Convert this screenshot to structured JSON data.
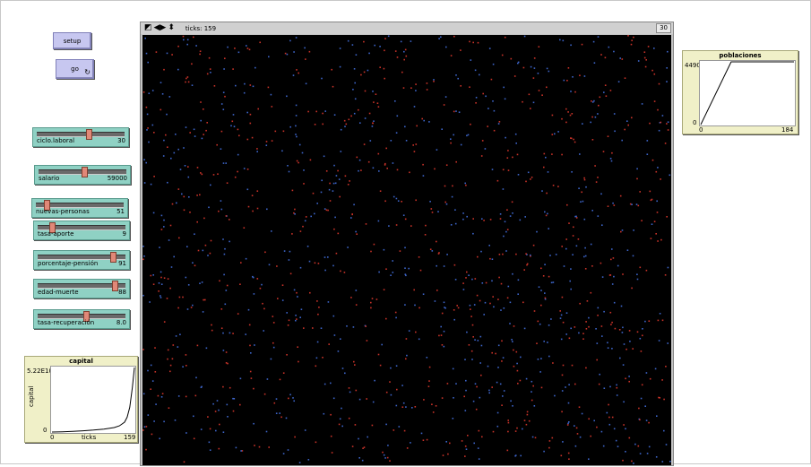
{
  "buttons": {
    "setup": "setup",
    "go": "go",
    "forever_icon": "↻"
  },
  "sliders": [
    {
      "label": "ciclo.laboral",
      "value": "30",
      "fraction": 0.6
    },
    {
      "label": "salario",
      "value": "59000",
      "fraction": 0.52
    },
    {
      "label": "nuevas-personas",
      "value": "51",
      "fraction": 0.1
    },
    {
      "label": "tasa-aporte",
      "value": "9",
      "fraction": 0.14
    },
    {
      "label": "porcentaje-pensión",
      "value": "91",
      "fraction": 0.88
    },
    {
      "label": "edad-muerte",
      "value": "88",
      "fraction": 0.9
    },
    {
      "label": "tasa-recuperación",
      "value": "8.0",
      "fraction": 0.55
    }
  ],
  "view": {
    "ticks_label": "ticks: 159",
    "speed_label": "30",
    "icons": [
      "wrap-icon",
      "horizontal-arrows-icon",
      "vertical-arrows-icon"
    ],
    "colors": {
      "background": "#000000",
      "agent_red": "#c83228",
      "agent_blue": "#3c64c8"
    }
  },
  "plot_capital": {
    "title": "capital",
    "ymax": "5.22E10",
    "ymin": "0",
    "xmin": "0",
    "xmax": "159",
    "xlabel": "ticks",
    "ylabel": "capital"
  },
  "plot_poblaciones": {
    "title": "poblaciones",
    "ymax": "4490",
    "ymin": "0",
    "xmin": "0",
    "xmax": "184"
  },
  "chart_data": [
    {
      "type": "line",
      "title": "capital",
      "xlabel": "ticks",
      "ylabel": "capital",
      "xlim": [
        0,
        159
      ],
      "ylim": [
        0,
        52200000000.0
      ],
      "series": [
        {
          "x": [
            0,
            20,
            40,
            60,
            80,
            100,
            120,
            130,
            140,
            145,
            150,
            155,
            159
          ],
          "y": [
            0,
            200000000.0,
            600000000.0,
            1000000000.0,
            1600000000.0,
            2400000000.0,
            3600000000.0,
            5000000000.0,
            8000000000.0,
            12000000000.0,
            20000000000.0,
            36000000000.0,
            52200000000.0
          ]
        }
      ]
    },
    {
      "type": "line",
      "title": "poblaciones",
      "xlim": [
        0,
        184
      ],
      "ylim": [
        0,
        4490
      ],
      "series": [
        {
          "x": [
            0,
            60,
            100,
            184
          ],
          "y": [
            0,
            4490,
            4490,
            4490
          ]
        }
      ]
    }
  ]
}
